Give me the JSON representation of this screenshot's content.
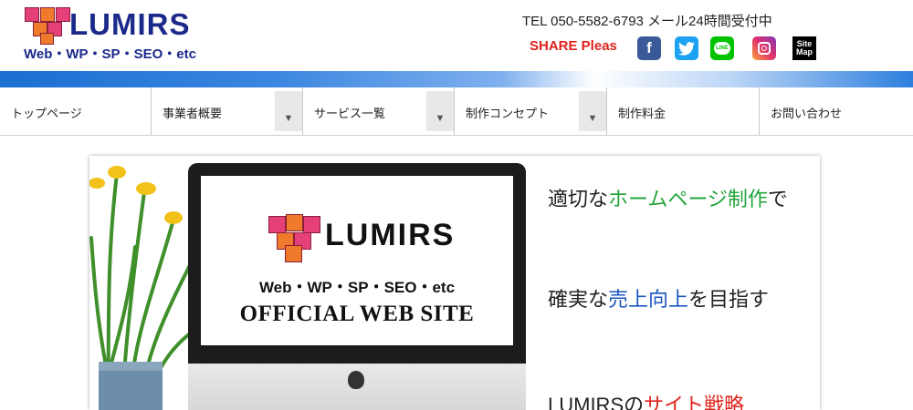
{
  "header": {
    "logo_title": "LUMIRS",
    "logo_subtitle": "Web・WP・SP・SEO・etc",
    "tel": "TEL 050-5582-6793 メール24時間受付中",
    "share_label": "SHARE Pleas",
    "social": {
      "facebook": "f",
      "line": "LINE",
      "sitemap_top": "Site",
      "sitemap_bottom": "Map"
    }
  },
  "nav": {
    "items": [
      {
        "label": "トップページ",
        "has_dropdown": false
      },
      {
        "label": "事業者概要",
        "has_dropdown": true
      },
      {
        "label": "サービス一覧",
        "has_dropdown": true
      },
      {
        "label": "制作コンセプト",
        "has_dropdown": true
      },
      {
        "label": "制作料金",
        "has_dropdown": false
      },
      {
        "label": "お問い合わせ",
        "has_dropdown": false
      }
    ],
    "dropdown_glyph": "▼"
  },
  "hero": {
    "screen_title": "LUMIRS",
    "screen_subtitle": "Web・WP・SP・SEO・etc",
    "screen_official": "OFFICIAL WEB SITE",
    "tagline1": {
      "pre": "適切な",
      "hl": "ホームページ制作",
      "post": "で"
    },
    "tagline2": {
      "pre": "確実な",
      "hl": "売上向上",
      "post": "を目指す"
    },
    "tagline3": {
      "pre": "LUMIRSの",
      "hl": "サイト戦略",
      "post": ""
    }
  },
  "colors": {
    "brand_blue": "#1b2a8a",
    "share_red": "#e0231c",
    "highlight_green": "#22a43a",
    "highlight_blue": "#1b56c2",
    "highlight_red": "#e0231c"
  }
}
